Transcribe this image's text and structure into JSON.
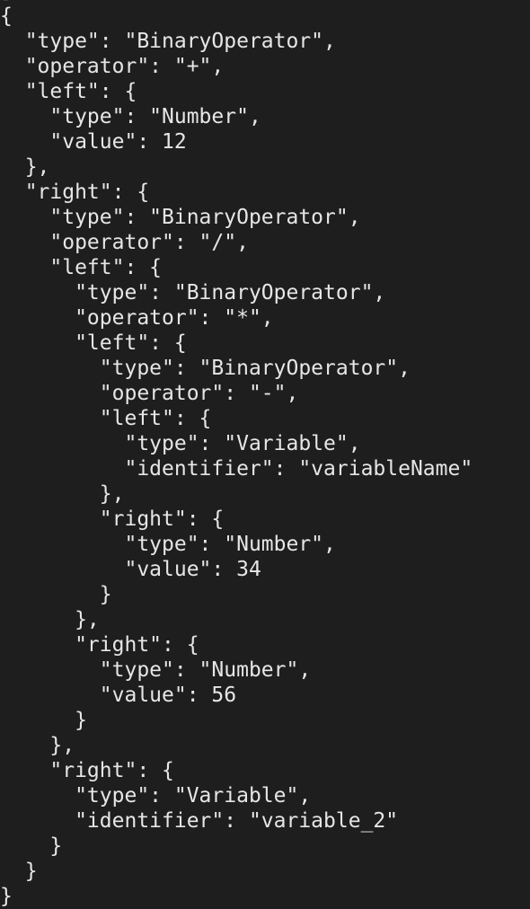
{
  "editor": {
    "background": "#1e1e1e",
    "text_color": "#e6e6e6",
    "lines": [
      "]",
      "{",
      "  \"type\": \"BinaryOperator\",",
      "  \"operator\": \"+\",",
      "  \"left\": {",
      "    \"type\": \"Number\",",
      "    \"value\": 12",
      "  },",
      "  \"right\": {",
      "    \"type\": \"BinaryOperator\",",
      "    \"operator\": \"/\",",
      "    \"left\": {",
      "      \"type\": \"BinaryOperator\",",
      "      \"operator\": \"*\",",
      "      \"left\": {",
      "        \"type\": \"BinaryOperator\",",
      "        \"operator\": \"-\",",
      "        \"left\": {",
      "          \"type\": \"Variable\",",
      "          \"identifier\": \"variableName\"",
      "        },",
      "        \"right\": {",
      "          \"type\": \"Number\",",
      "          \"value\": 34",
      "        }",
      "      },",
      "      \"right\": {",
      "        \"type\": \"Number\",",
      "        \"value\": 56",
      "      }",
      "    },",
      "    \"right\": {",
      "      \"type\": \"Variable\",",
      "      \"identifier\": \"variable_2\"",
      "    }",
      "  }",
      "}"
    ]
  }
}
